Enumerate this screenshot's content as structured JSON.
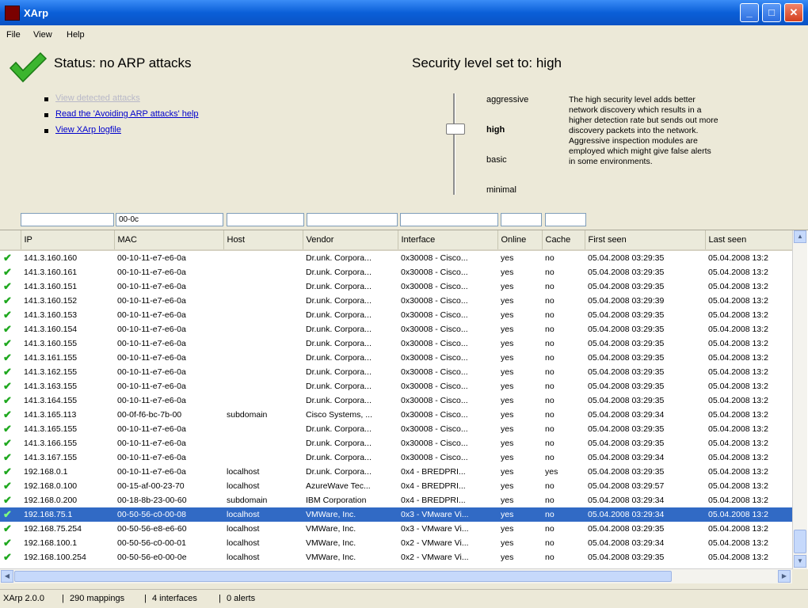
{
  "window": {
    "title": "XArp"
  },
  "menu": [
    {
      "label": "File"
    },
    {
      "label": "View"
    },
    {
      "label": "Help"
    }
  ],
  "status": {
    "text": "Status:  no ARP attacks",
    "security": "Security level set to:  high",
    "links": [
      {
        "label": "View detected attacks",
        "enabled": false
      },
      {
        "label": "Read the 'Avoiding ARP attacks' help",
        "enabled": true
      },
      {
        "label": "View XArp logfile",
        "enabled": true
      }
    ]
  },
  "levels": [
    {
      "label": "aggressive"
    },
    {
      "label": "high"
    },
    {
      "label": "basic"
    },
    {
      "label": "minimal"
    }
  ],
  "selected_level": "high",
  "level_description": "The high security level adds better network discovery which results in a higher detection rate but sends out more discovery packets into the network. Aggressive inspection modules are employed which might give false alerts in some environments.",
  "filters": [
    "",
    "00-0c",
    "",
    "",
    "",
    "",
    ""
  ],
  "columns": [
    {
      "label": "IP"
    },
    {
      "label": "MAC"
    },
    {
      "label": "Host"
    },
    {
      "label": "Vendor"
    },
    {
      "label": "Interface"
    },
    {
      "label": "Online"
    },
    {
      "label": "Cache"
    },
    {
      "label": "First seen"
    },
    {
      "label": "Last seen"
    }
  ],
  "rows": [
    {
      "ip": "141.3.160.160",
      "mac": "00-10-11-e7-e6-0a",
      "host": "",
      "vendor": "Dr.unk. Corpora...",
      "iface": "0x30008 - Cisco...",
      "online": "yes",
      "cache": "no",
      "first": "05.04.2008 03:29:35",
      "last": "05.04.2008 13:2"
    },
    {
      "ip": "141.3.160.161",
      "mac": "00-10-11-e7-e6-0a",
      "host": "",
      "vendor": "Dr.unk. Corpora...",
      "iface": "0x30008 - Cisco...",
      "online": "yes",
      "cache": "no",
      "first": "05.04.2008 03:29:35",
      "last": "05.04.2008 13:2"
    },
    {
      "ip": "141.3.160.151",
      "mac": "00-10-11-e7-e6-0a",
      "host": "",
      "vendor": "Dr.unk. Corpora...",
      "iface": "0x30008 - Cisco...",
      "online": "yes",
      "cache": "no",
      "first": "05.04.2008 03:29:35",
      "last": "05.04.2008 13:2"
    },
    {
      "ip": "141.3.160.152",
      "mac": "00-10-11-e7-e6-0a",
      "host": "",
      "vendor": "Dr.unk. Corpora...",
      "iface": "0x30008 - Cisco...",
      "online": "yes",
      "cache": "no",
      "first": "05.04.2008 03:29:39",
      "last": "05.04.2008 13:2"
    },
    {
      "ip": "141.3.160.153",
      "mac": "00-10-11-e7-e6-0a",
      "host": "",
      "vendor": "Dr.unk. Corpora...",
      "iface": "0x30008 - Cisco...",
      "online": "yes",
      "cache": "no",
      "first": "05.04.2008 03:29:35",
      "last": "05.04.2008 13:2"
    },
    {
      "ip": "141.3.160.154",
      "mac": "00-10-11-e7-e6-0a",
      "host": "",
      "vendor": "Dr.unk. Corpora...",
      "iface": "0x30008 - Cisco...",
      "online": "yes",
      "cache": "no",
      "first": "05.04.2008 03:29:35",
      "last": "05.04.2008 13:2"
    },
    {
      "ip": "141.3.160.155",
      "mac": "00-10-11-e7-e6-0a",
      "host": "",
      "vendor": "Dr.unk. Corpora...",
      "iface": "0x30008 - Cisco...",
      "online": "yes",
      "cache": "no",
      "first": "05.04.2008 03:29:35",
      "last": "05.04.2008 13:2"
    },
    {
      "ip": "141.3.161.155",
      "mac": "00-10-11-e7-e6-0a",
      "host": "",
      "vendor": "Dr.unk. Corpora...",
      "iface": "0x30008 - Cisco...",
      "online": "yes",
      "cache": "no",
      "first": "05.04.2008 03:29:35",
      "last": "05.04.2008 13:2"
    },
    {
      "ip": "141.3.162.155",
      "mac": "00-10-11-e7-e6-0a",
      "host": "",
      "vendor": "Dr.unk. Corpora...",
      "iface": "0x30008 - Cisco...",
      "online": "yes",
      "cache": "no",
      "first": "05.04.2008 03:29:35",
      "last": "05.04.2008 13:2"
    },
    {
      "ip": "141.3.163.155",
      "mac": "00-10-11-e7-e6-0a",
      "host": "",
      "vendor": "Dr.unk. Corpora...",
      "iface": "0x30008 - Cisco...",
      "online": "yes",
      "cache": "no",
      "first": "05.04.2008 03:29:35",
      "last": "05.04.2008 13:2"
    },
    {
      "ip": "141.3.164.155",
      "mac": "00-10-11-e7-e6-0a",
      "host": "",
      "vendor": "Dr.unk. Corpora...",
      "iface": "0x30008 - Cisco...",
      "online": "yes",
      "cache": "no",
      "first": "05.04.2008 03:29:35",
      "last": "05.04.2008 13:2"
    },
    {
      "ip": "141.3.165.113",
      "mac": "00-0f-f6-bc-7b-00",
      "host": "subdomain",
      "vendor": "Cisco Systems, ...",
      "iface": "0x30008 - Cisco...",
      "online": "yes",
      "cache": "no",
      "first": "05.04.2008 03:29:34",
      "last": "05.04.2008 13:2"
    },
    {
      "ip": "141.3.165.155",
      "mac": "00-10-11-e7-e6-0a",
      "host": "",
      "vendor": "Dr.unk. Corpora...",
      "iface": "0x30008 - Cisco...",
      "online": "yes",
      "cache": "no",
      "first": "05.04.2008 03:29:35",
      "last": "05.04.2008 13:2"
    },
    {
      "ip": "141.3.166.155",
      "mac": "00-10-11-e7-e6-0a",
      "host": "",
      "vendor": "Dr.unk. Corpora...",
      "iface": "0x30008 - Cisco...",
      "online": "yes",
      "cache": "no",
      "first": "05.04.2008 03:29:35",
      "last": "05.04.2008 13:2"
    },
    {
      "ip": "141.3.167.155",
      "mac": "00-10-11-e7-e6-0a",
      "host": "",
      "vendor": "Dr.unk. Corpora...",
      "iface": "0x30008 - Cisco...",
      "online": "yes",
      "cache": "no",
      "first": "05.04.2008 03:29:34",
      "last": "05.04.2008 13:2"
    },
    {
      "ip": "192.168.0.1",
      "mac": "00-10-11-e7-e6-0a",
      "host": "localhost",
      "vendor": "Dr.unk. Corpora...",
      "iface": "0x4 - BREDPRI...",
      "online": "yes",
      "cache": "yes",
      "first": "05.04.2008 03:29:35",
      "last": "05.04.2008 13:2"
    },
    {
      "ip": "192.168.0.100",
      "mac": "00-15-af-00-23-70",
      "host": "localhost",
      "vendor": "AzureWave Tec...",
      "iface": "0x4 - BREDPRI...",
      "online": "yes",
      "cache": "no",
      "first": "05.04.2008 03:29:57",
      "last": "05.04.2008 13:2"
    },
    {
      "ip": "192.168.0.200",
      "mac": "00-18-8b-23-00-60",
      "host": "subdomain",
      "vendor": "IBM Corporation",
      "iface": "0x4 - BREDPRI...",
      "online": "yes",
      "cache": "no",
      "first": "05.04.2008 03:29:34",
      "last": "05.04.2008 13:2"
    },
    {
      "ip": "192.168.75.1",
      "mac": "00-50-56-c0-00-08",
      "host": "localhost",
      "vendor": "VMWare, Inc.",
      "iface": "0x3 - VMware Vi...",
      "online": "yes",
      "cache": "no",
      "first": "05.04.2008 03:29:34",
      "last": "05.04.2008 13:2",
      "selected": true
    },
    {
      "ip": "192.168.75.254",
      "mac": "00-50-56-e8-e6-60",
      "host": "localhost",
      "vendor": "VMWare, Inc.",
      "iface": "0x3 - VMware Vi...",
      "online": "yes",
      "cache": "no",
      "first": "05.04.2008 03:29:35",
      "last": "05.04.2008 13:2"
    },
    {
      "ip": "192.168.100.1",
      "mac": "00-50-56-c0-00-01",
      "host": "localhost",
      "vendor": "VMWare, Inc.",
      "iface": "0x2 - VMware Vi...",
      "online": "yes",
      "cache": "no",
      "first": "05.04.2008 03:29:34",
      "last": "05.04.2008 13:2"
    },
    {
      "ip": "192.168.100.254",
      "mac": "00-50-56-e0-00-0e",
      "host": "localhost",
      "vendor": "VMWare, Inc.",
      "iface": "0x2 - VMware Vi...",
      "online": "yes",
      "cache": "no",
      "first": "05.04.2008 03:29:35",
      "last": "05.04.2008 13:2"
    }
  ],
  "statusbar": [
    "XArp 2.0.0",
    "290 mappings",
    "4 interfaces",
    "0 alerts"
  ],
  "icons": {
    "ok": "check-icon",
    "status": "big-check-icon"
  },
  "colors": {
    "selected_row": "#316ac5",
    "check": "#1fa81f",
    "titlebar": "#0a5fd8"
  }
}
